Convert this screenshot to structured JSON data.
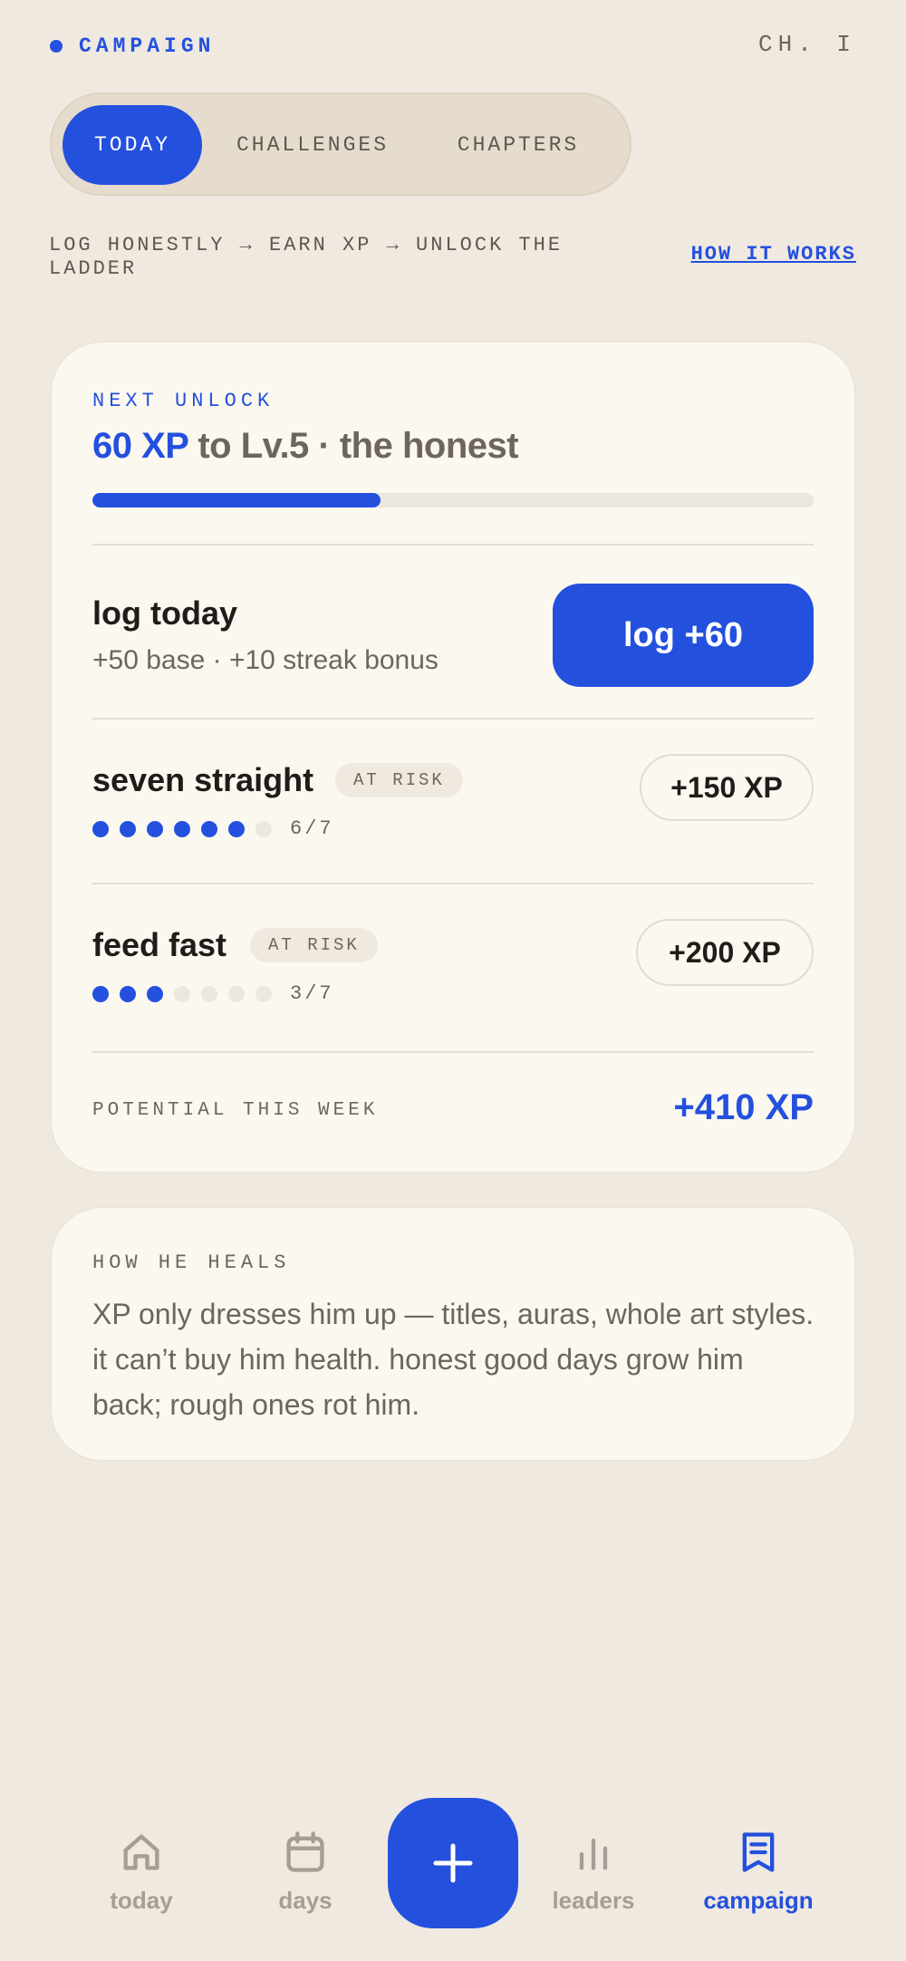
{
  "header": {
    "brand": "CAMPAIGN",
    "chapter": "CH. I"
  },
  "tabs": [
    {
      "label": "TODAY",
      "active": true
    },
    {
      "label": "CHALLENGES",
      "active": false
    },
    {
      "label": "CHAPTERS",
      "active": false
    }
  ],
  "subline": {
    "flow": "LOG HONESTLY → EARN XP → UNLOCK THE LADDER",
    "link": "HOW IT WORKS"
  },
  "unlock": {
    "eyebrow": "NEXT UNLOCK",
    "xp": "60 XP",
    "target": " to Lv.5 · the honest",
    "progress": 0.4
  },
  "log": {
    "title": "log today",
    "sub": "+50 base · +10 streak bonus",
    "button": "log +60"
  },
  "challenges": [
    {
      "name": "seven straight",
      "badge": "AT RISK",
      "done": 6,
      "total": 7,
      "count": "6/7",
      "reward": "+150 XP"
    },
    {
      "name": "feed fast",
      "badge": "AT RISK",
      "done": 3,
      "total": 7,
      "count": "3/7",
      "reward": "+200 XP"
    }
  ],
  "potential": {
    "label": "POTENTIAL THIS WEEK",
    "value": "+410 XP"
  },
  "heal": {
    "eyebrow": "HOW HE HEALS",
    "body": "XP only dresses him up — titles, auras, whole art styles. it can’t buy him health. honest good days grow him back; rough ones rot him."
  },
  "nav": {
    "items": [
      {
        "label": "today",
        "icon": "home-icon",
        "active": false
      },
      {
        "label": "days",
        "icon": "calendar-icon",
        "active": false
      },
      {
        "label": "leaders",
        "icon": "bar-chart-icon",
        "active": false
      },
      {
        "label": "campaign",
        "icon": "bookmark-list-icon",
        "active": true
      }
    ],
    "fab_icon": "plus-icon"
  },
  "colors": {
    "accent": "#2450de",
    "background": "#efe9e0",
    "card": "#fbf8f0"
  }
}
